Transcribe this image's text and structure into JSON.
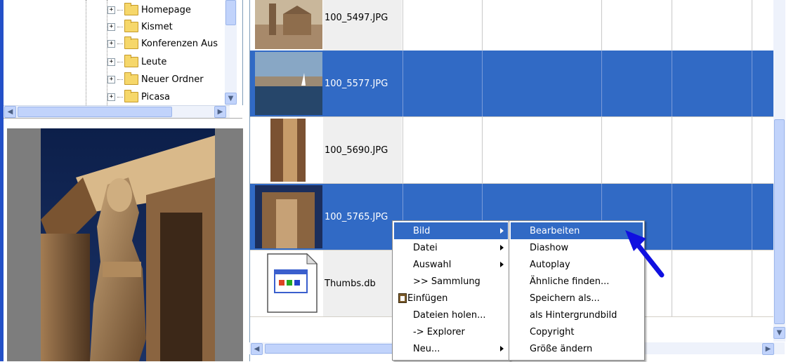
{
  "tree": {
    "items": [
      {
        "label": "Homepage"
      },
      {
        "label": "Kismet"
      },
      {
        "label": "Konferenzen Aus"
      },
      {
        "label": "Leute"
      },
      {
        "label": "Neuer Ordner"
      },
      {
        "label": "Picasa"
      }
    ]
  },
  "files": [
    {
      "name": "100_5497.JPG",
      "selected": false
    },
    {
      "name": "100_5577.JPG",
      "selected": true
    },
    {
      "name": "100_5690.JPG",
      "selected": false
    },
    {
      "name": "100_5765.JPG",
      "selected": true
    },
    {
      "name": "Thumbs.db",
      "selected": false
    }
  ],
  "context_menu": {
    "items": [
      {
        "label": "Bild",
        "submenu": true,
        "highlighted": true
      },
      {
        "label": "Datei",
        "submenu": true
      },
      {
        "label": "Auswahl",
        "submenu": true
      },
      {
        "label": ">> Sammlung",
        "submenu": false
      },
      {
        "label": "Einfügen",
        "submenu": false,
        "icon": "clipboard-icon"
      },
      {
        "label": "Dateien holen...",
        "submenu": false
      },
      {
        "label": "-> Explorer",
        "submenu": false
      },
      {
        "label": "Neu...",
        "submenu": true
      }
    ]
  },
  "submenu": {
    "items": [
      {
        "label": "Bearbeiten",
        "highlighted": true
      },
      {
        "label": "Diashow"
      },
      {
        "label": "Autoplay"
      },
      {
        "label": "Ähnliche finden..."
      },
      {
        "label": "Speichern als..."
      },
      {
        "label": "als Hintergrundbild"
      },
      {
        "label": "Copyright"
      },
      {
        "label": "Größe ändern"
      }
    ]
  },
  "colors": {
    "selection": "#316ac5",
    "annotation_arrow": "#1010e0",
    "window_border": "#2350c8"
  },
  "icons": {
    "annotation": "blue-pointer-arrow-icon",
    "scroll_left": "◀",
    "scroll_right": "▶",
    "scroll_up": "▲",
    "scroll_down": "▼"
  }
}
